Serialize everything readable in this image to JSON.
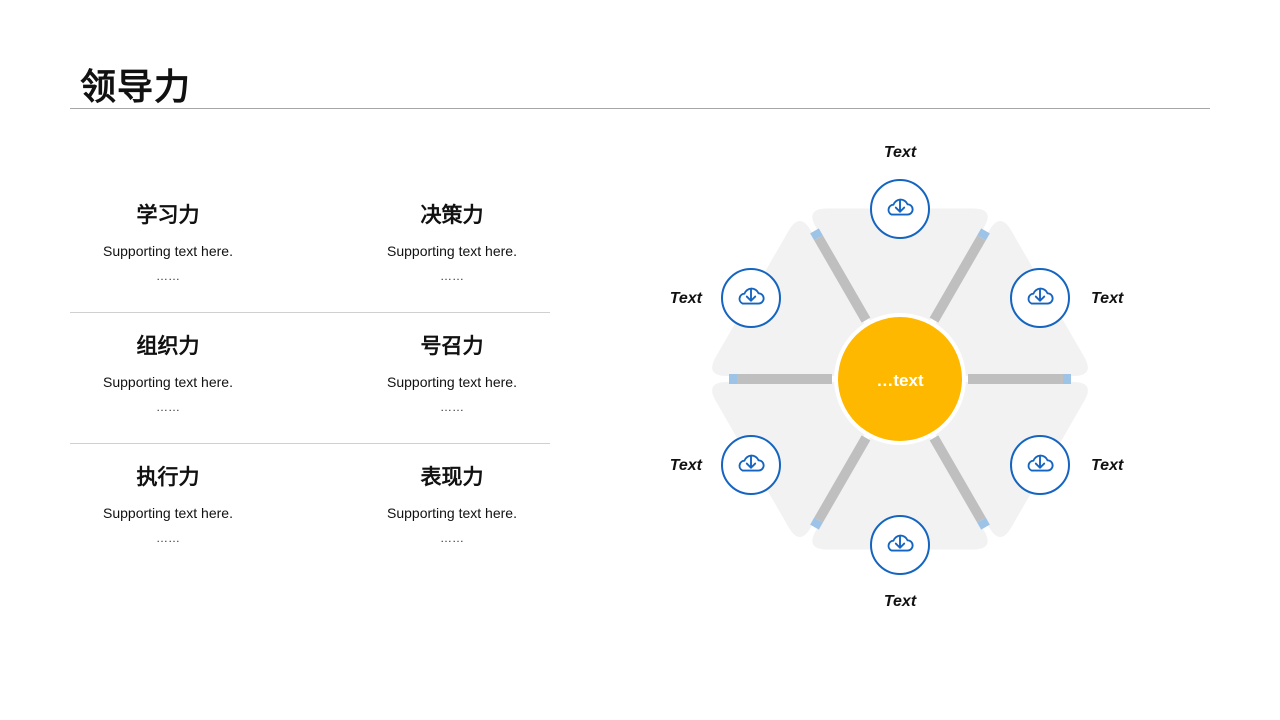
{
  "title": "领导力",
  "grid": [
    {
      "heading": "学习力",
      "support": "Supporting  text here.",
      "ellipsis": "……"
    },
    {
      "heading": "决策力",
      "support": "Supporting  text here.",
      "ellipsis": "……"
    },
    {
      "heading": "组织力",
      "support": "Supporting  text here.",
      "ellipsis": "……"
    },
    {
      "heading": "号召力",
      "support": "Supporting  text here.",
      "ellipsis": "……"
    },
    {
      "heading": "执行力",
      "support": "Supporting  text here.",
      "ellipsis": "……"
    },
    {
      "heading": "表现力",
      "support": "Supporting  text here.",
      "ellipsis": "……"
    }
  ],
  "diagram": {
    "center_label": "…text",
    "nodes": [
      {
        "label": "Text",
        "icon": "cloud-download-icon"
      },
      {
        "label": "Text",
        "icon": "cloud-download-icon"
      },
      {
        "label": "Text",
        "icon": "cloud-download-icon"
      },
      {
        "label": "Text",
        "icon": "cloud-download-icon"
      },
      {
        "label": "Text",
        "icon": "cloud-download-icon"
      },
      {
        "label": "Text",
        "icon": "cloud-download-icon"
      }
    ],
    "colors": {
      "center": "#FFB800",
      "icon": "#1565C0",
      "segment": "#F2F2F2",
      "spoke": "#BFBFBF",
      "spoke_tip": "#9DC3E6"
    }
  }
}
